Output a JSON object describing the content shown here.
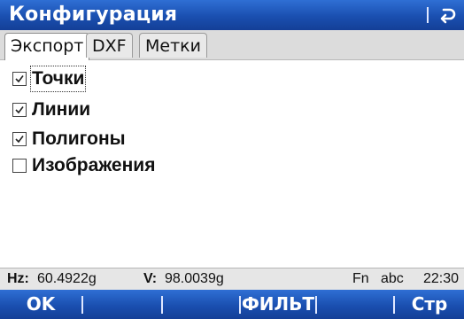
{
  "window": {
    "title": "Конфигурация",
    "back_icon": "undo-arrow-icon"
  },
  "tabs": [
    {
      "label": "Экспорт",
      "active": true
    },
    {
      "label": "DXF",
      "active": false
    },
    {
      "label": "Метки",
      "active": false
    }
  ],
  "checkboxes": [
    {
      "label": "Точки",
      "checked": true,
      "focused": true
    },
    {
      "label": "Линии",
      "checked": true,
      "focused": false
    },
    {
      "label": "Полигоны",
      "checked": true,
      "focused": false
    },
    {
      "label": "Изображения",
      "checked": false,
      "focused": false
    }
  ],
  "status": {
    "hz_label": "Hz:",
    "hz_value": "60.4922g",
    "v_label": "V:",
    "v_value": "98.0039g",
    "fn": "Fn",
    "input_mode": "abc",
    "time": "22:30"
  },
  "softkeys": [
    {
      "label": "OK"
    },
    {
      "label": ""
    },
    {
      "label": ""
    },
    {
      "label": "ФИЛЬТ"
    },
    {
      "label": ""
    },
    {
      "label": "Стр"
    }
  ],
  "colors": {
    "bar_blue": "#1a4fb0",
    "tab_strip": "#dcdcdc",
    "status_bg": "#e6e6e6"
  }
}
